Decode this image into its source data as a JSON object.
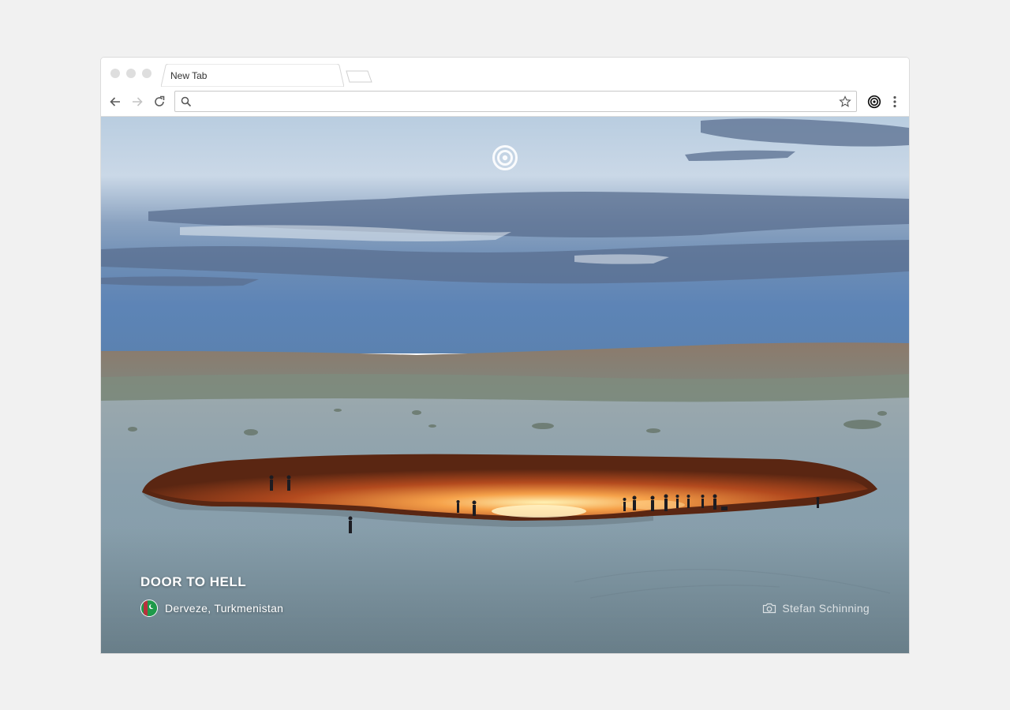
{
  "browser": {
    "tab": {
      "title": "New Tab"
    },
    "omnibox": {
      "value": "",
      "placeholder": ""
    },
    "icons": {
      "back": "arrow-left-icon",
      "forward": "arrow-right-icon",
      "reload": "reload-icon",
      "search": "search-icon",
      "bookmark": "star-icon",
      "extension": "target-icon",
      "menu": "three-dots-icon"
    }
  },
  "background_photo": {
    "title": "DOOR TO HELL",
    "location": "Derveze, Turkmenistan",
    "credit": "Stefan Schinning",
    "icons": {
      "center": "target-logo-icon",
      "flag": "turkmenistan-flag-icon",
      "camera": "camera-icon"
    }
  },
  "colors": {
    "page_bg": "#f1f1f1",
    "sky_top": "#b9cde0",
    "sky_mid": "#5e7fa5",
    "ground": "#8fa4ae",
    "crater_glow": "#f08a3a"
  }
}
